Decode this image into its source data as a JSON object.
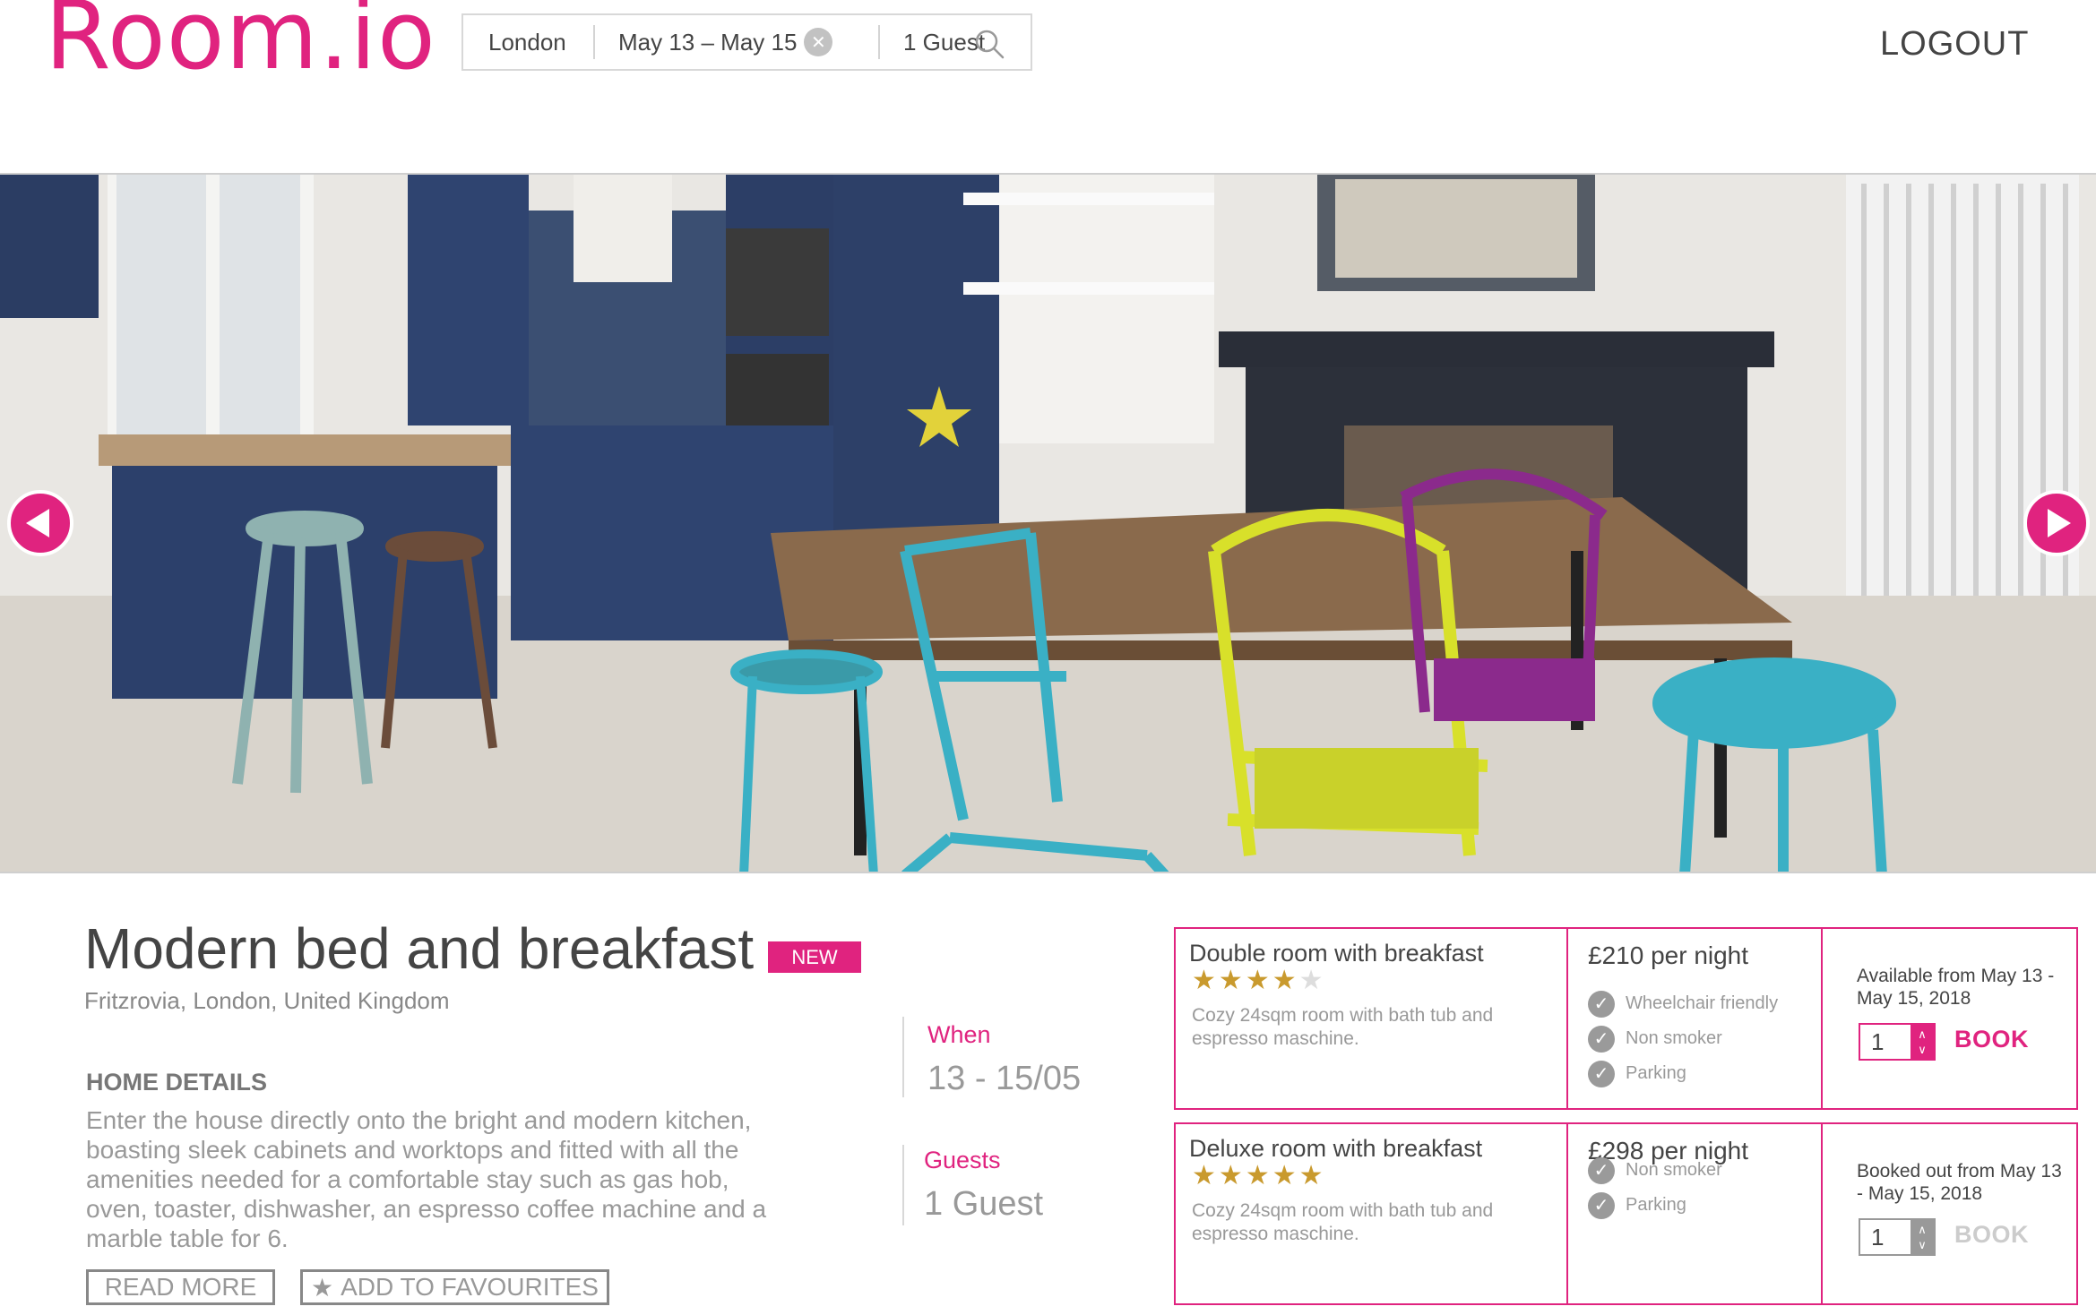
{
  "brand": {
    "logo": "Room.io",
    "accent": "#e0237f"
  },
  "search": {
    "city": "London",
    "dates": "May 13 – May 15",
    "guests": "1 Guest"
  },
  "header": {
    "logout": "LOGOUT"
  },
  "listing": {
    "title": "Modern bed and breakfast",
    "badge": "NEW",
    "location": "Fritzrovia, London, United Kingdom",
    "details_heading": "HOME DETAILS",
    "details_text": "Enter the house directly onto the bright and modern kitchen, boasting sleek cabinets and worktops and fitted with all the amenities needed for a comfortable stay such as gas hob, oven, toaster, dishwasher, an espresso coffee machine and a marble table for 6.",
    "read_more": "READ MORE",
    "add_to_favourites": "ADD TO FAVOURITES"
  },
  "booking": {
    "when_label": "When",
    "when_value": "13 - 15/05",
    "guests_label": "Guests",
    "guests_value": "1 Guest"
  },
  "rooms": [
    {
      "name": "Double room with breakfast",
      "rating": 4,
      "rating_max": 5,
      "description": "Cozy 24sqm room with bath tub and espresso maschine.",
      "price": "£210 per night",
      "amenities": [
        "Wheelchair friendly",
        "Non smoker",
        "Parking"
      ],
      "availability": "Available from May 13 - May 15, 2018",
      "quantity": "1",
      "book_label": "BOOK",
      "bookable": true
    },
    {
      "name": "Deluxe room with breakfast",
      "rating": 5,
      "rating_max": 5,
      "description": "Cozy 24sqm room with bath tub and espresso maschine.",
      "price": "£298 per night",
      "amenities": [
        "Non smoker",
        "Parking"
      ],
      "availability": "Booked out from May 13 - May 15, 2018",
      "quantity": "1",
      "book_label": "BOOK",
      "bookable": false
    }
  ]
}
